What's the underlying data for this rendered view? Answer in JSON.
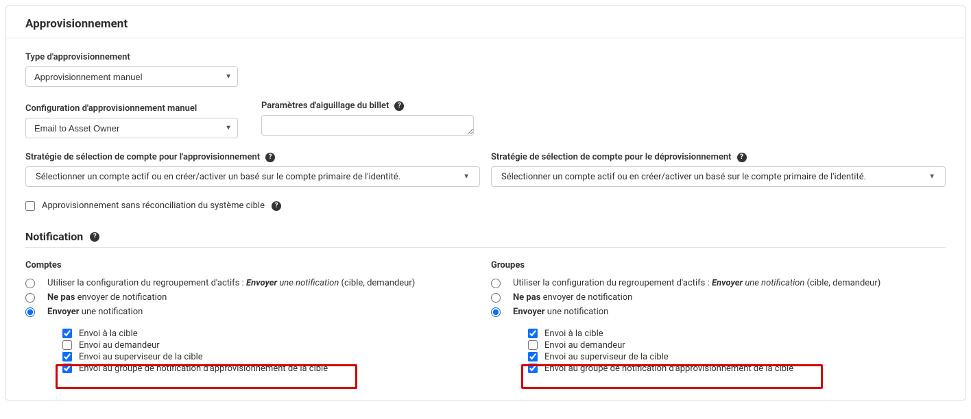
{
  "provisioning": {
    "heading": "Approvisionnement",
    "type_label": "Type d'approvisionnement",
    "type_value": "Approvisionnement manuel",
    "config_label": "Configuration d'approvisionnement manuel",
    "config_value": "Email to Asset Owner",
    "ticket_params_label": "Paramètres d'aiguillage du billet",
    "ticket_params_value": "",
    "strategy_prov_label": "Stratégie de sélection de compte pour l'approvisionnement",
    "strategy_deprov_label": "Stratégie de sélection de compte pour le déprovisionnement",
    "strategy_value": "Sélectionner un compte actif ou en créer/activer un basé sur le compte primaire de l'identité.",
    "no_reconcile_label": "Approvisionnement sans réconciliation du système cible"
  },
  "notification": {
    "heading": "Notification",
    "accounts_title": "Comptes",
    "groups_title": "Groupes",
    "opt_use_config_prefix": "Utiliser la configuration du regroupement d'actifs : ",
    "opt_use_config_action_bold": "Envoyer",
    "opt_use_config_action_italic": " une notification",
    "opt_use_config_suffix": " (cible, demandeur)",
    "opt_dont_send_bold": "Ne pas",
    "opt_dont_send_rest": " envoyer de notification",
    "opt_send_bold": "Envoyer",
    "opt_send_rest": " une notification",
    "chk_target": "Envoi à la cible",
    "chk_requester": "Envoi au demandeur",
    "chk_supervisor": "Envoi au superviseur de la cible",
    "chk_prov_group": "Envoi au groupe de notification d'approvisionnement de la cible"
  }
}
